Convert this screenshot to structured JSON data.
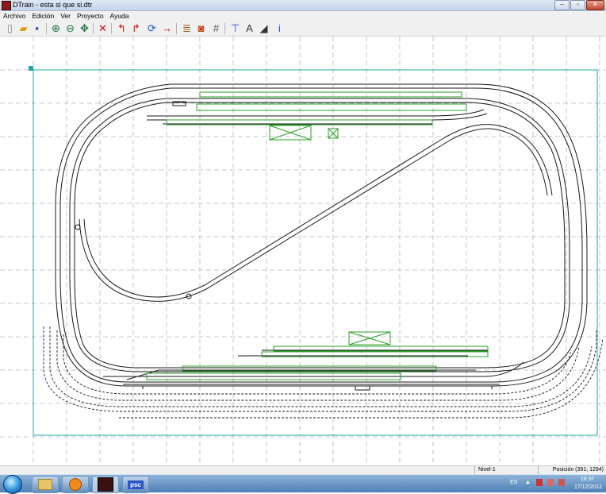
{
  "window": {
    "title": "DTrain - esta si que si.dtr"
  },
  "menu": [
    "Archivo",
    "Edición",
    "Ver",
    "Proyecto",
    "Ayuda"
  ],
  "toolbar_icons": [
    {
      "name": "new-file-icon",
      "glyph": "▯",
      "color": "#888"
    },
    {
      "name": "open-folder-icon",
      "glyph": "▰",
      "color": "#d9a21c"
    },
    {
      "name": "save-icon",
      "glyph": "▪",
      "color": "#2446a8"
    },
    {
      "name": "zoom-in-icon",
      "glyph": "⊕",
      "color": "#1f6f3a"
    },
    {
      "name": "zoom-out-icon",
      "glyph": "⊖",
      "color": "#1f6f3a"
    },
    {
      "name": "pan-icon",
      "glyph": "✥",
      "color": "#1f6f3a"
    },
    {
      "name": "delete-icon",
      "glyph": "✕",
      "color": "#d01010"
    },
    {
      "name": "curve-left-icon",
      "glyph": "↰",
      "color": "#d01010"
    },
    {
      "name": "curve-right-icon",
      "glyph": "↱",
      "color": "#d01010"
    },
    {
      "name": "rotate-icon",
      "glyph": "⟳",
      "color": "#2255cc"
    },
    {
      "name": "straight-track-icon",
      "glyph": "→",
      "color": "#d01010"
    },
    {
      "name": "list-icon",
      "glyph": "≣",
      "color": "#8a5a10"
    },
    {
      "name": "locomotive-icon",
      "glyph": "◙",
      "color": "#c04010"
    },
    {
      "name": "grid-icon",
      "glyph": "#",
      "color": "#555"
    },
    {
      "name": "ruler-icon",
      "glyph": "⊤",
      "color": "#2255cc"
    },
    {
      "name": "text-tool-icon",
      "glyph": "A",
      "color": "#333"
    },
    {
      "name": "slope-icon",
      "glyph": "◢",
      "color": "#333"
    },
    {
      "name": "info-icon",
      "glyph": "i",
      "color": "#2255cc"
    }
  ],
  "status": {
    "level": "Nivel-1",
    "position": "Posición (391; 1294)"
  },
  "tray": {
    "lang": "ES",
    "time": "18:37",
    "date": "17/12/2012"
  },
  "taskbar": {
    "app_label": "psc"
  },
  "colors": {
    "board_border": "#22a7a7",
    "track": "#1a1a1a",
    "platform": "#2aa02a",
    "grid": "#b8b8b8"
  }
}
